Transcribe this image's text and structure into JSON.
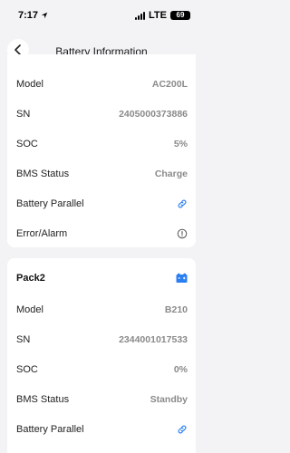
{
  "status_bar": {
    "time": "7:17",
    "network": "LTE",
    "battery": "69"
  },
  "nav": {
    "title": "Battery Information"
  },
  "main_battery": {
    "rows": [
      {
        "label": "Model",
        "value": "AC200L"
      },
      {
        "label": "SN",
        "value": "2405000373886"
      },
      {
        "label": "SOC",
        "value": "5%"
      },
      {
        "label": "BMS Status",
        "value": "Charge"
      },
      {
        "label": "Battery Parallel",
        "icon": "link-icon"
      },
      {
        "label": "Error/Alarm",
        "icon": "alert-circle-icon"
      }
    ]
  },
  "pack2": {
    "title": "Pack2",
    "header_icon": "battery-pack-icon",
    "rows": [
      {
        "label": "Model",
        "value": "B210"
      },
      {
        "label": "SN",
        "value": "2344001017533"
      },
      {
        "label": "SOC",
        "value": "0%"
      },
      {
        "label": "BMS Status",
        "value": "Standby"
      },
      {
        "label": "Battery Parallel",
        "icon": "link-icon"
      }
    ]
  },
  "colors": {
    "background": "#f3f3f5",
    "card": "#ffffff",
    "accent": "#2b7ff0",
    "value_text": "#8a8a8a"
  }
}
